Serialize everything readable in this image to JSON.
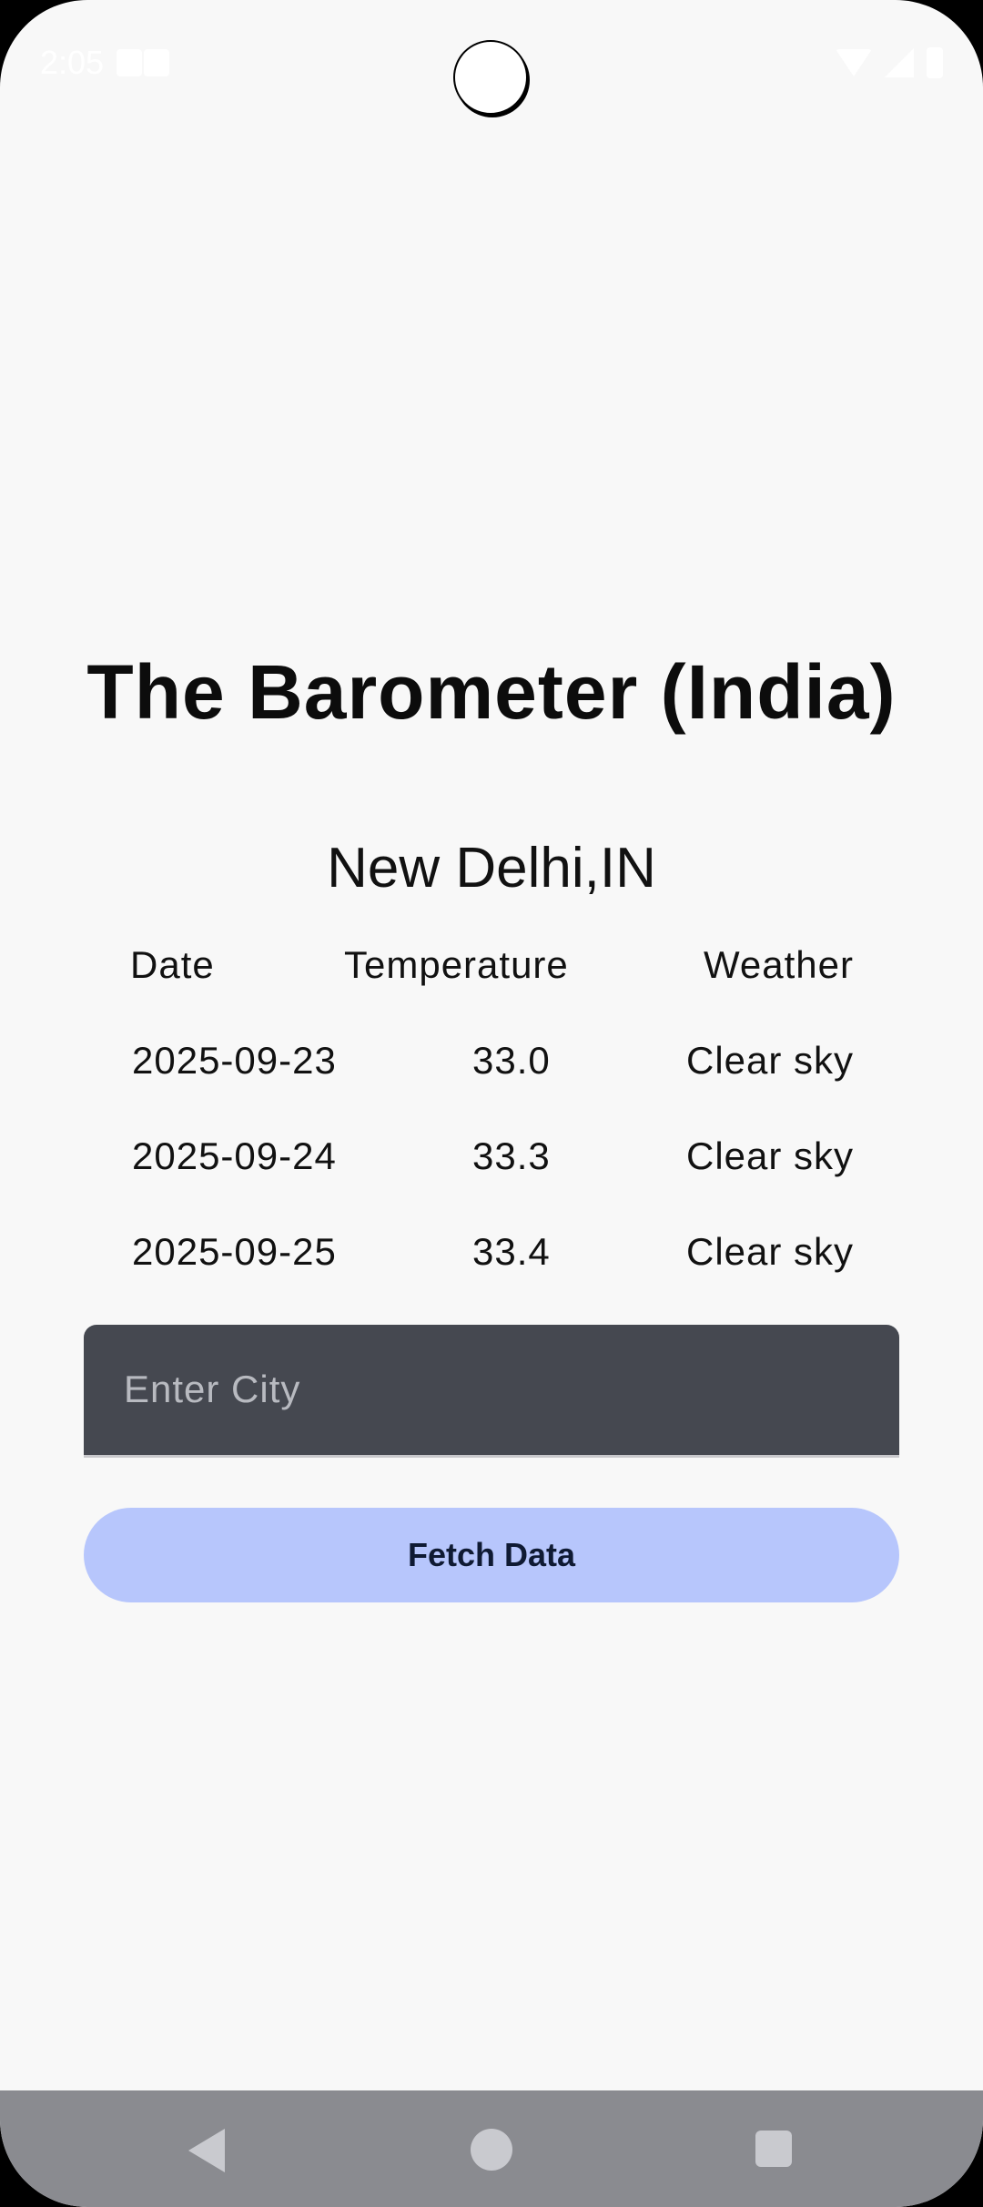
{
  "status_bar": {
    "time": "2:05"
  },
  "app": {
    "title": "The Barometer (India)",
    "city": "New Delhi,IN"
  },
  "forecast": {
    "headers": {
      "date": "Date",
      "temperature": "Temperature",
      "weather": "Weather"
    },
    "rows": [
      {
        "date": "2025-09-23",
        "temperature": "33.0",
        "weather": "Clear sky"
      },
      {
        "date": "2025-09-24",
        "temperature": "33.3",
        "weather": "Clear sky"
      },
      {
        "date": "2025-09-25",
        "temperature": "33.4",
        "weather": "Clear sky"
      }
    ]
  },
  "city_input": {
    "placeholder": "Enter City",
    "value": ""
  },
  "fetch_button": {
    "label": "Fetch Data"
  },
  "nav_bar": {
    "icons": [
      "back-icon",
      "home-icon",
      "recents-icon"
    ]
  },
  "colors": {
    "background": "#f8f8f8",
    "input_background": "#454850",
    "button_background": "#b7c6fc",
    "nav_bar_background": "#8a8b90"
  }
}
